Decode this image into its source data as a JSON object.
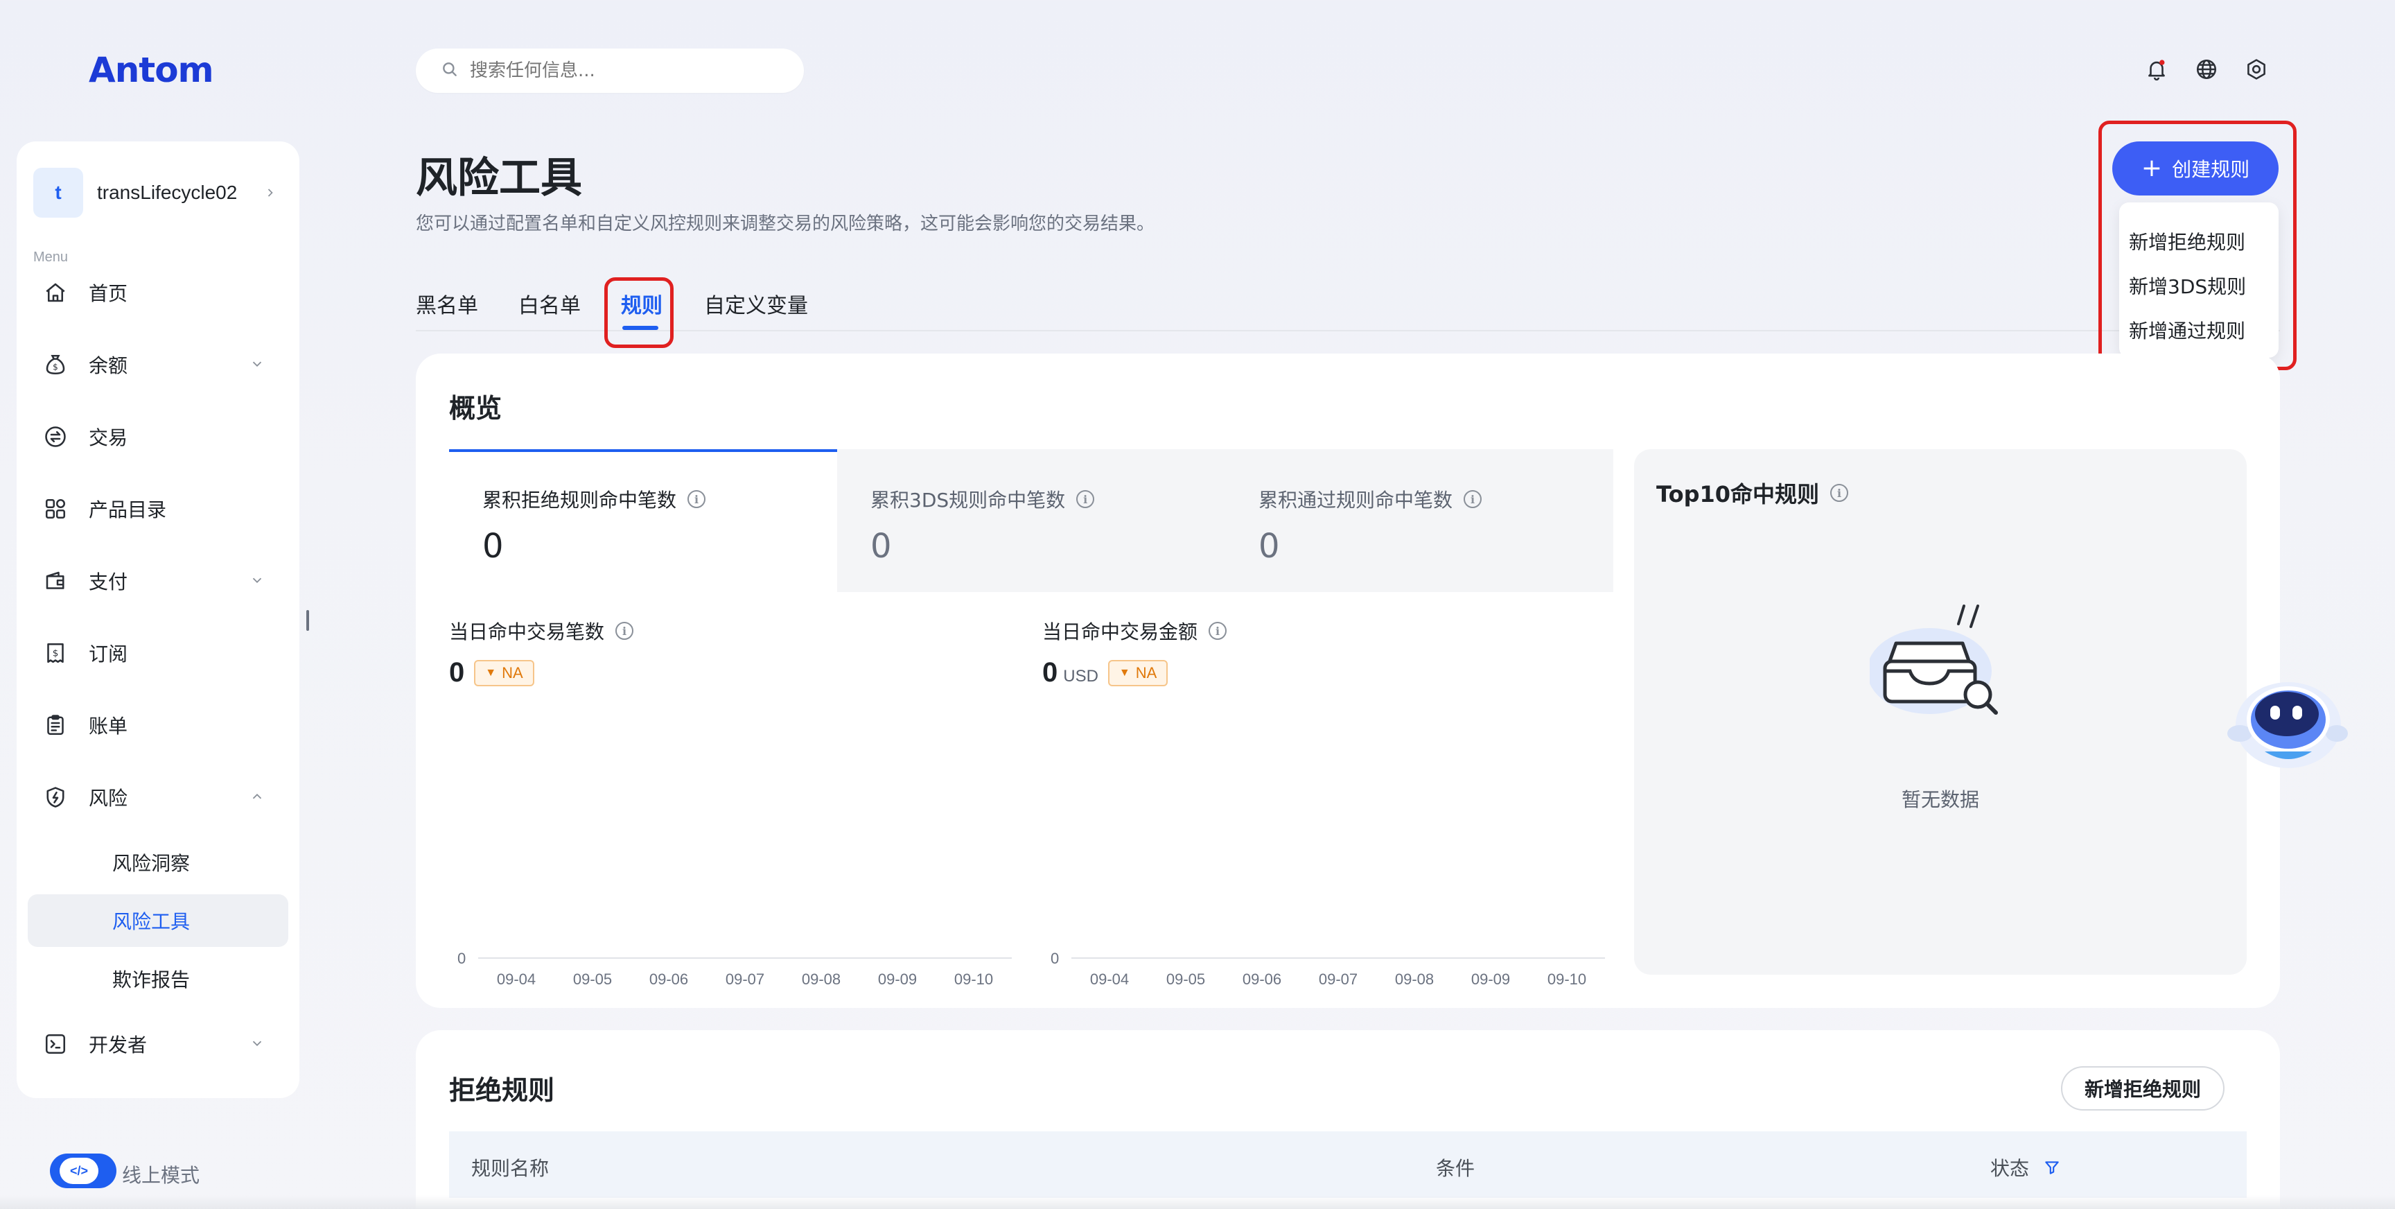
{
  "brand": {
    "logo_text": "Antom",
    "color": "#1c3bd6"
  },
  "header": {
    "search_placeholder": "搜索任何信息...",
    "icons": [
      "bell-icon",
      "globe-icon",
      "settings-icon"
    ],
    "notification_dot_color": "#e02020"
  },
  "sidebar": {
    "account": {
      "initial": "t",
      "name": "transLifecycle02"
    },
    "menu_label": "Menu",
    "items": [
      {
        "label": "首页",
        "icon": "home-icon"
      },
      {
        "label": "余额",
        "icon": "money-bag-icon"
      },
      {
        "label": "交易",
        "icon": "exchange-icon"
      },
      {
        "label": "产品目录",
        "icon": "grid-icon"
      },
      {
        "label": "支付",
        "icon": "wallet-icon"
      },
      {
        "label": "订阅",
        "icon": "dollar-doc-icon"
      },
      {
        "label": "账单",
        "icon": "clipboard-icon"
      },
      {
        "label": "风险",
        "icon": "shield-icon"
      },
      {
        "label": "开发者",
        "icon": "terminal-icon"
      }
    ],
    "risk_sub": [
      {
        "label": "风险洞察"
      },
      {
        "label": "风险工具"
      },
      {
        "label": "欺诈报告"
      }
    ],
    "mode_label": "线上模式",
    "mode_toggle_on": true
  },
  "page": {
    "title": "风险工具",
    "description": "您可以通过配置名单和自定义风控规则来调整交易的风险策略，这可能会影响您的交易结果。",
    "tabs": [
      "黑名单",
      "白名单",
      "规则",
      "自定义变量"
    ],
    "active_tab": "规则"
  },
  "create": {
    "button_label": "创建规则",
    "menu": [
      "新增拒绝规则",
      "新增3DS规则",
      "新增通过规则"
    ]
  },
  "overview": {
    "title": "概览",
    "stats": [
      {
        "label": "累积拒绝规则命中笔数",
        "value": "0"
      },
      {
        "label": "累积3DS规则命中笔数",
        "value": "0"
      },
      {
        "label": "累积通过规则命中笔数",
        "value": "0"
      }
    ],
    "daily_count": {
      "label": "当日命中交易笔数",
      "value": "0",
      "badge": "NA"
    },
    "daily_amount": {
      "label": "当日命中交易金额",
      "value": "0",
      "unit": "USD",
      "badge": "NA"
    },
    "top10": {
      "title": "Top10命中规则",
      "empty_text": "暂无数据"
    }
  },
  "chart_data": [
    {
      "type": "line",
      "categories": [
        "09-04",
        "09-05",
        "09-06",
        "09-07",
        "09-08",
        "09-09",
        "09-10"
      ],
      "series": [
        {
          "values": [
            0,
            0,
            0,
            0,
            0,
            0,
            0
          ]
        }
      ],
      "y_ticks": [
        "0"
      ]
    },
    {
      "type": "line",
      "categories": [
        "09-04",
        "09-05",
        "09-06",
        "09-07",
        "09-08",
        "09-09",
        "09-10"
      ],
      "series": [
        {
          "values": [
            0,
            0,
            0,
            0,
            0,
            0,
            0
          ]
        }
      ],
      "y_ticks": [
        "0"
      ]
    }
  ],
  "reject": {
    "title": "拒绝规则",
    "add_button": "新增拒绝规则",
    "columns": [
      "规则名称",
      "条件",
      "状态"
    ]
  },
  "colors": {
    "accent": "#1e5ef0",
    "create_button": "#3d5ef5",
    "highlight_box": "#e02020",
    "badge_text": "#e0790b"
  }
}
